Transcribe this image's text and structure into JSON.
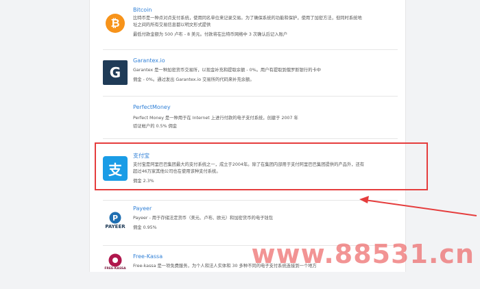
{
  "colors": {
    "accent_link": "#2f7fd6",
    "highlight_border": "#e53c3c",
    "arrow": "#e53c3c",
    "watermark": "#eb5a5a"
  },
  "items": [
    {
      "name": "Bitcoin",
      "icon": "bitcoin-icon",
      "icon_text": "Bitcoin",
      "desc": "比特币是一种点对点支付系统，使用同名单位来记录交易。为了确保系统的功能和保护，使用了加密方法，但同时系统地址之间的所有交易信息都以明文形式提供",
      "fee": "最低付款金额为 500 卢布 - 8 美元。付款将在比特币网络中 3 次确认后记入账户"
    },
    {
      "name": "Garantex.io",
      "icon": "garantex-icon",
      "icon_text": "G",
      "desc": "Garantex 是一种加密货币交易所，以现金补充和提取余额 - 0%。用户有提取到俄罗斯银行的卡中",
      "fee": "佣金 - 0%。通过发出 Garantex.io 交易所的代码来补充余额。"
    },
    {
      "name": "PerfectMoney",
      "icon": "perfectmoney-icon",
      "icon_text": "",
      "desc": "Perfect Money 是一种用于在 Internet 上进行付款的电子支付系统，创建于 2007 年",
      "fee": "验证帐户的 0.5% 佣金"
    },
    {
      "name": "支付宝",
      "icon": "alipay-icon",
      "icon_text": "支",
      "desc": "支付宝是阿里巴巴集团最大的支付系统之一，成立于2004年。除了在集团内部用于支付阿里巴巴集团提供的产品外，还有超过46万家其他公司也在使用该种支付系统。",
      "fee": "佣金 2.3%"
    },
    {
      "name": "Payeer",
      "icon": "payeer-icon",
      "icon_text": "PAYEER",
      "desc": "Payeer - 用于存储法定货币（美元、卢布、欧元）和加密货币的电子钱包",
      "fee": "佣金 0.95%"
    },
    {
      "name": "Free-Kassa",
      "icon": "freekassa-icon",
      "icon_text": "FREE-KASSA",
      "desc": "Free-kassa 是一项免费服务，为个人和法人实体和 30 多种不同的电子支付系统连接到一个地方",
      "fee": ""
    }
  ],
  "watermark": "www.88531.cn"
}
